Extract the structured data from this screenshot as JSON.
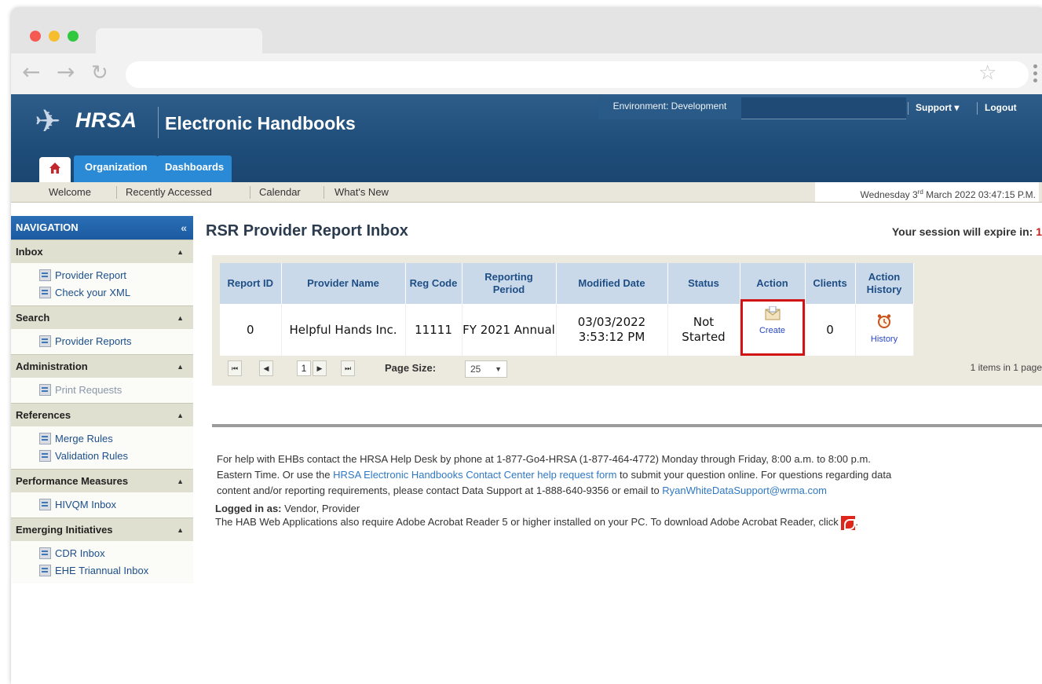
{
  "header": {
    "logo_text": "HRSA",
    "app_title": "Electronic Handbooks",
    "environment": "Environment: Development",
    "support": "Support ▾",
    "logout": "Logout",
    "tabs": [
      "Organization",
      "Dashboards"
    ]
  },
  "subnav": {
    "items": [
      "Welcome",
      "Recently Accessed",
      "Calendar",
      "What's New"
    ],
    "date_prefix": "Wednesday 3",
    "date_sup": "rd",
    "date_suffix": " March 2022 03:47:15 P.M."
  },
  "sidebar": {
    "title": "NAVIGATION",
    "collapse": "«",
    "sections": [
      {
        "title": "Inbox",
        "links": [
          "Provider Report",
          "Check your XML"
        ]
      },
      {
        "title": "Search",
        "links": [
          "Provider Reports"
        ]
      },
      {
        "title": "Administration",
        "links": [
          "Print Requests"
        ]
      },
      {
        "title": "References",
        "links": [
          "Merge Rules",
          "Validation Rules"
        ]
      },
      {
        "title": "Performance Measures",
        "links": [
          "HIVQM Inbox"
        ]
      },
      {
        "title": "Emerging Initiatives",
        "links": [
          "CDR Inbox",
          "EHE Triannual Inbox"
        ]
      }
    ]
  },
  "main": {
    "title": "RSR Provider Report Inbox",
    "session_text": "Your session will expire in: ",
    "session_value": "1",
    "table": {
      "headers": [
        "Report ID",
        "Provider Name",
        "Reg Code",
        "Reporting Period",
        "Modified Date",
        "Status",
        "Action",
        "Clients",
        "Action History"
      ],
      "row": {
        "report_id": "0",
        "provider_name": "Helpful Hands Inc.",
        "reg_code": "11111",
        "reporting_period": "FY 2021 Annual",
        "modified_date": "03/03/2022 3:53:12 PM",
        "status": "Not Started",
        "action": "Create",
        "clients": "0",
        "history": "History"
      }
    },
    "pager": {
      "first": "⏮",
      "prev": "◀",
      "current_page": "1",
      "next": "▶",
      "last": "⏭",
      "page_size_label": "Page Size:",
      "page_size": "25",
      "items_info": "1 items in 1 page"
    },
    "help": {
      "line1": "For help with EHBs contact the HRSA Help Desk by phone at 1-877-Go4-HRSA (1-877-464-4772) Monday through Friday, 8:00 a.m. to 8:00 p.m.",
      "line2_a": "Eastern Time. Or use the ",
      "line2_link": "HRSA Electronic Handbooks Contact Center help request form",
      "line2_b": " to submit your question online. For questions regarding data",
      "line3_a": "content and/or reporting requirements, please contact Data Support at 1-888-640-9356 or email to ",
      "line3_link": "RyanWhiteDataSupport@wrma.com"
    },
    "login": {
      "label": "Logged in as:",
      "value": " Vendor, Provider",
      "acrobat_text": "The HAB Web Applications also require Adobe Acrobat Reader 5 or higher installed on your PC. To download Adobe Acrobat Reader, click ",
      "after_icon": "."
    }
  },
  "colors": {
    "header_blue": "#1e4d7a",
    "tab_blue": "#2a8ad6",
    "highlight_red": "#d11313"
  }
}
